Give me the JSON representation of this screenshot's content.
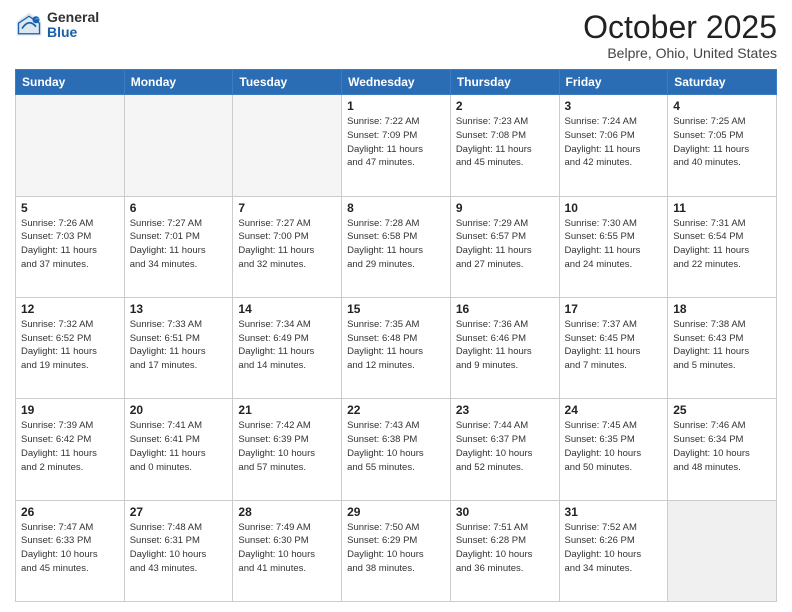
{
  "header": {
    "logo_general": "General",
    "logo_blue": "Blue",
    "title": "October 2025",
    "location": "Belpre, Ohio, United States"
  },
  "days_of_week": [
    "Sunday",
    "Monday",
    "Tuesday",
    "Wednesday",
    "Thursday",
    "Friday",
    "Saturday"
  ],
  "weeks": [
    [
      {
        "day": "",
        "info": "",
        "empty": true
      },
      {
        "day": "",
        "info": "",
        "empty": true
      },
      {
        "day": "",
        "info": "",
        "empty": true
      },
      {
        "day": "1",
        "info": "Sunrise: 7:22 AM\nSunset: 7:09 PM\nDaylight: 11 hours\nand 47 minutes.",
        "empty": false
      },
      {
        "day": "2",
        "info": "Sunrise: 7:23 AM\nSunset: 7:08 PM\nDaylight: 11 hours\nand 45 minutes.",
        "empty": false
      },
      {
        "day": "3",
        "info": "Sunrise: 7:24 AM\nSunset: 7:06 PM\nDaylight: 11 hours\nand 42 minutes.",
        "empty": false
      },
      {
        "day": "4",
        "info": "Sunrise: 7:25 AM\nSunset: 7:05 PM\nDaylight: 11 hours\nand 40 minutes.",
        "empty": false
      }
    ],
    [
      {
        "day": "5",
        "info": "Sunrise: 7:26 AM\nSunset: 7:03 PM\nDaylight: 11 hours\nand 37 minutes.",
        "empty": false
      },
      {
        "day": "6",
        "info": "Sunrise: 7:27 AM\nSunset: 7:01 PM\nDaylight: 11 hours\nand 34 minutes.",
        "empty": false
      },
      {
        "day": "7",
        "info": "Sunrise: 7:27 AM\nSunset: 7:00 PM\nDaylight: 11 hours\nand 32 minutes.",
        "empty": false
      },
      {
        "day": "8",
        "info": "Sunrise: 7:28 AM\nSunset: 6:58 PM\nDaylight: 11 hours\nand 29 minutes.",
        "empty": false
      },
      {
        "day": "9",
        "info": "Sunrise: 7:29 AM\nSunset: 6:57 PM\nDaylight: 11 hours\nand 27 minutes.",
        "empty": false
      },
      {
        "day": "10",
        "info": "Sunrise: 7:30 AM\nSunset: 6:55 PM\nDaylight: 11 hours\nand 24 minutes.",
        "empty": false
      },
      {
        "day": "11",
        "info": "Sunrise: 7:31 AM\nSunset: 6:54 PM\nDaylight: 11 hours\nand 22 minutes.",
        "empty": false
      }
    ],
    [
      {
        "day": "12",
        "info": "Sunrise: 7:32 AM\nSunset: 6:52 PM\nDaylight: 11 hours\nand 19 minutes.",
        "empty": false
      },
      {
        "day": "13",
        "info": "Sunrise: 7:33 AM\nSunset: 6:51 PM\nDaylight: 11 hours\nand 17 minutes.",
        "empty": false
      },
      {
        "day": "14",
        "info": "Sunrise: 7:34 AM\nSunset: 6:49 PM\nDaylight: 11 hours\nand 14 minutes.",
        "empty": false
      },
      {
        "day": "15",
        "info": "Sunrise: 7:35 AM\nSunset: 6:48 PM\nDaylight: 11 hours\nand 12 minutes.",
        "empty": false
      },
      {
        "day": "16",
        "info": "Sunrise: 7:36 AM\nSunset: 6:46 PM\nDaylight: 11 hours\nand 9 minutes.",
        "empty": false
      },
      {
        "day": "17",
        "info": "Sunrise: 7:37 AM\nSunset: 6:45 PM\nDaylight: 11 hours\nand 7 minutes.",
        "empty": false
      },
      {
        "day": "18",
        "info": "Sunrise: 7:38 AM\nSunset: 6:43 PM\nDaylight: 11 hours\nand 5 minutes.",
        "empty": false
      }
    ],
    [
      {
        "day": "19",
        "info": "Sunrise: 7:39 AM\nSunset: 6:42 PM\nDaylight: 11 hours\nand 2 minutes.",
        "empty": false
      },
      {
        "day": "20",
        "info": "Sunrise: 7:41 AM\nSunset: 6:41 PM\nDaylight: 11 hours\nand 0 minutes.",
        "empty": false
      },
      {
        "day": "21",
        "info": "Sunrise: 7:42 AM\nSunset: 6:39 PM\nDaylight: 10 hours\nand 57 minutes.",
        "empty": false
      },
      {
        "day": "22",
        "info": "Sunrise: 7:43 AM\nSunset: 6:38 PM\nDaylight: 10 hours\nand 55 minutes.",
        "empty": false
      },
      {
        "day": "23",
        "info": "Sunrise: 7:44 AM\nSunset: 6:37 PM\nDaylight: 10 hours\nand 52 minutes.",
        "empty": false
      },
      {
        "day": "24",
        "info": "Sunrise: 7:45 AM\nSunset: 6:35 PM\nDaylight: 10 hours\nand 50 minutes.",
        "empty": false
      },
      {
        "day": "25",
        "info": "Sunrise: 7:46 AM\nSunset: 6:34 PM\nDaylight: 10 hours\nand 48 minutes.",
        "empty": false
      }
    ],
    [
      {
        "day": "26",
        "info": "Sunrise: 7:47 AM\nSunset: 6:33 PM\nDaylight: 10 hours\nand 45 minutes.",
        "empty": false
      },
      {
        "day": "27",
        "info": "Sunrise: 7:48 AM\nSunset: 6:31 PM\nDaylight: 10 hours\nand 43 minutes.",
        "empty": false
      },
      {
        "day": "28",
        "info": "Sunrise: 7:49 AM\nSunset: 6:30 PM\nDaylight: 10 hours\nand 41 minutes.",
        "empty": false
      },
      {
        "day": "29",
        "info": "Sunrise: 7:50 AM\nSunset: 6:29 PM\nDaylight: 10 hours\nand 38 minutes.",
        "empty": false
      },
      {
        "day": "30",
        "info": "Sunrise: 7:51 AM\nSunset: 6:28 PM\nDaylight: 10 hours\nand 36 minutes.",
        "empty": false
      },
      {
        "day": "31",
        "info": "Sunrise: 7:52 AM\nSunset: 6:26 PM\nDaylight: 10 hours\nand 34 minutes.",
        "empty": false
      },
      {
        "day": "",
        "info": "",
        "empty": true,
        "shaded": true
      }
    ]
  ]
}
